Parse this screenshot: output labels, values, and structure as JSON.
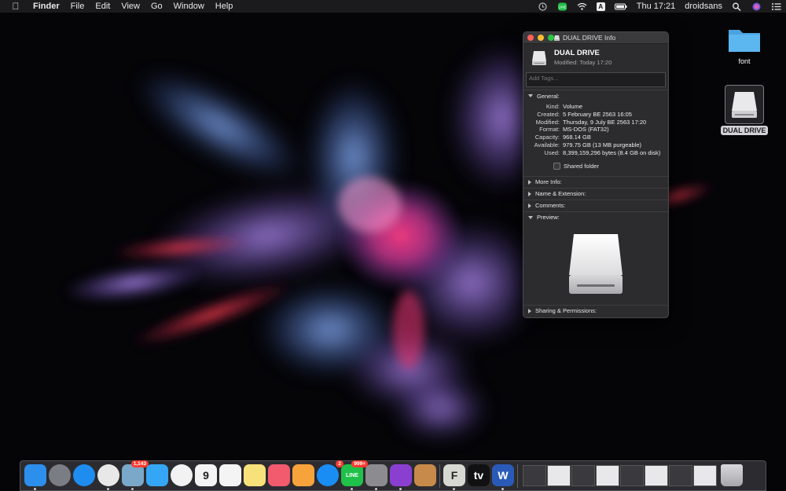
{
  "menubar": {
    "app_name": "Finder",
    "menus": [
      "File",
      "Edit",
      "View",
      "Go",
      "Window",
      "Help"
    ],
    "input_source": "A",
    "clock": "Thu 17:21",
    "user": "droidsans"
  },
  "desktop": {
    "icons": [
      {
        "label": "font",
        "kind": "folder"
      },
      {
        "label": "DUAL DRIVE",
        "kind": "external-drive",
        "selected": true
      }
    ]
  },
  "info_window": {
    "title": "DUAL DRIVE Info",
    "name": "DUAL DRIVE",
    "modified_line": "Modified: Today 17:20",
    "tags_placeholder": "Add Tags...",
    "general": {
      "header": "General:",
      "rows": [
        {
          "key": "Kind:",
          "value": "Volume"
        },
        {
          "key": "Created:",
          "value": "5 February BE 2563 16:05"
        },
        {
          "key": "Modified:",
          "value": "Thursday, 9 July BE 2563 17:20"
        },
        {
          "key": "Format:",
          "value": "MS-DOS (FAT32)"
        },
        {
          "key": "Capacity:",
          "value": "968.14 GB"
        },
        {
          "key": "Available:",
          "value": "979.75 GB (13 MB purgeable)"
        },
        {
          "key": "Used:",
          "value": "8,399,159,296 bytes (8.4 GB on disk)"
        }
      ],
      "shared_folder_label": "Shared folder"
    },
    "sections": [
      {
        "label": "More Info:",
        "expanded": false
      },
      {
        "label": "Name & Extension:",
        "expanded": false
      },
      {
        "label": "Comments:",
        "expanded": false
      },
      {
        "label": "Preview:",
        "expanded": true
      }
    ],
    "sharing_label": "Sharing & Permissions:"
  },
  "dock": {
    "apps": [
      {
        "name": "finder",
        "color": "#2c8fec",
        "running": true
      },
      {
        "name": "launchpad",
        "color": "#7b7d85",
        "running": false
      },
      {
        "name": "safari",
        "color": "#1f8cf0",
        "running": false
      },
      {
        "name": "chrome",
        "color": "#e8e8e8",
        "running": true
      },
      {
        "name": "preview",
        "color": "#7aa8c8",
        "running": true,
        "badge": "1,143"
      },
      {
        "name": "messages",
        "color": "#35a6f5",
        "running": false
      },
      {
        "name": "photos",
        "color": "#f2f2f2",
        "running": false
      },
      {
        "name": "calendar",
        "color": "#f4f4f4",
        "running": false,
        "text": "9"
      },
      {
        "name": "reminders",
        "color": "#f4f4f4",
        "running": false
      },
      {
        "name": "notes",
        "color": "#f7e17a",
        "running": false
      },
      {
        "name": "music",
        "color": "#f25a6e",
        "running": false
      },
      {
        "name": "pages",
        "color": "#f6a33b",
        "running": false
      },
      {
        "name": "app-store",
        "color": "#1a8df5",
        "running": false,
        "badge": "2"
      },
      {
        "name": "line",
        "color": "#20c14a",
        "running": true,
        "badge": "999+",
        "text": "LINE"
      },
      {
        "name": "system-preferences",
        "color": "#8c8c90",
        "running": true
      },
      {
        "name": "affinity-photo",
        "color": "#8a3fd0",
        "running": true
      },
      {
        "name": "calculator",
        "color": "#c88a4a",
        "running": false
      },
      {
        "name": "fontlab",
        "color": "#d8d8d2",
        "running": true,
        "text": "F"
      },
      {
        "name": "apple-tv",
        "color": "#111113",
        "running": false,
        "text": "tv"
      },
      {
        "name": "word",
        "color": "#2a5ab8",
        "running": true,
        "text": "W"
      }
    ],
    "minimized_count": 8,
    "trash": "trash"
  }
}
